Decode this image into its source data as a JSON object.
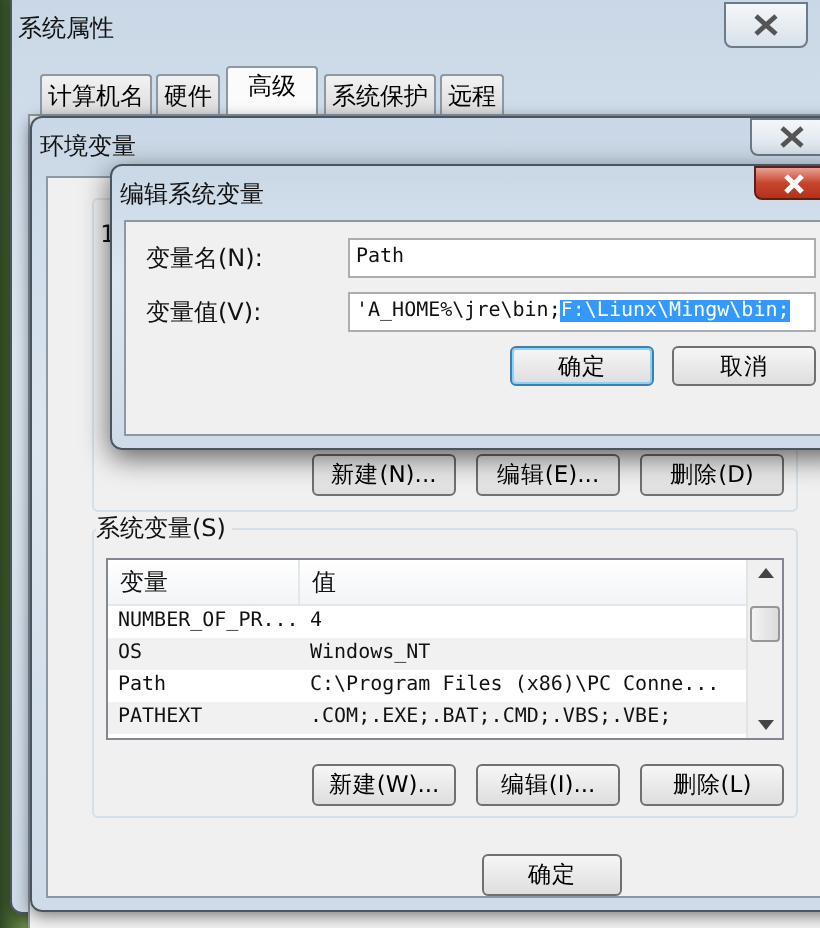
{
  "system_properties": {
    "title": "系统属性",
    "tabs": [
      {
        "label": "计算机名",
        "selected": false
      },
      {
        "label": "硬件",
        "selected": false
      },
      {
        "label": "高级",
        "selected": true
      },
      {
        "label": "系统保护",
        "selected": false
      },
      {
        "label": "远程",
        "selected": false
      }
    ]
  },
  "environment_variables": {
    "title": "环境变量",
    "user_group_fragment": "1",
    "user_buttons": [
      "新建(N)...",
      "编辑(E)...",
      "删除(D)"
    ],
    "system_group": {
      "label": "系统变量(S)",
      "columns": [
        "变量",
        "值"
      ],
      "rows": [
        {
          "variable": "NUMBER_OF_PR...",
          "value": "4"
        },
        {
          "variable": "OS",
          "value": "Windows_NT"
        },
        {
          "variable": "Path",
          "value": "C:\\Program Files (x86)\\PC Conne..."
        },
        {
          "variable": "PATHEXT",
          "value": ".COM;.EXE;.BAT;.CMD;.VBS;.VBE;"
        }
      ],
      "buttons": [
        "新建(W)...",
        "编辑(I)...",
        "删除(L)"
      ]
    },
    "ok_button": "确定"
  },
  "edit_dialog": {
    "title": "编辑系统变量",
    "name_label": "变量名(N):",
    "name_value": "Path",
    "value_label": "变量值(V):",
    "value_text": "'A_HOME%\\jre\\bin;",
    "value_selected_text": "F:\\Liunx\\Mingw\\bin;",
    "buttons": [
      {
        "label": "确定",
        "default": true
      },
      {
        "label": "取消",
        "default": false
      }
    ]
  }
}
